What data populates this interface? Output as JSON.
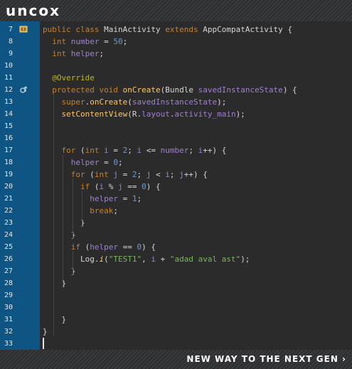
{
  "header": {
    "logo_text": "uncox"
  },
  "footer": {
    "tagline": "NEW WAY TO THE NEXT GEN ›"
  },
  "editor": {
    "line_numbers": [
      "7",
      "8",
      "9",
      "10",
      "11",
      "12",
      "13",
      "14",
      "15",
      "16",
      "17",
      "18",
      "19",
      "20",
      "21",
      "22",
      "23",
      "24",
      "25",
      "26",
      "27",
      "28",
      "29",
      "30",
      "31",
      "32",
      "33"
    ],
    "gutter_icons": [
      {
        "line": "7",
        "icon": "class-icon"
      },
      {
        "line": "12",
        "icon": "override-icon"
      }
    ],
    "lines": [
      "public class MainActivity extends AppCompatActivity {",
      "  int number = 50;",
      "  int helper;",
      "",
      "  @Override",
      "  protected void onCreate(Bundle savedInstanceState) {",
      "    super.onCreate(savedInstanceState);",
      "    setContentView(R.layout.activity_main);",
      "",
      "",
      "    for (int i = 2; i <= number; i++) {",
      "      helper = 0;",
      "      for (int j = 2; j < i; j++) {",
      "        if (i % j == 0) {",
      "          helper = 1;",
      "          break;",
      "        }",
      "      }",
      "      if (helper == 0) {",
      "        Log.i(\"TEST1\", i + \"adad aval ast\");",
      "      }",
      "    }",
      "",
      "",
      "    }",
      "}",
      ""
    ]
  }
}
